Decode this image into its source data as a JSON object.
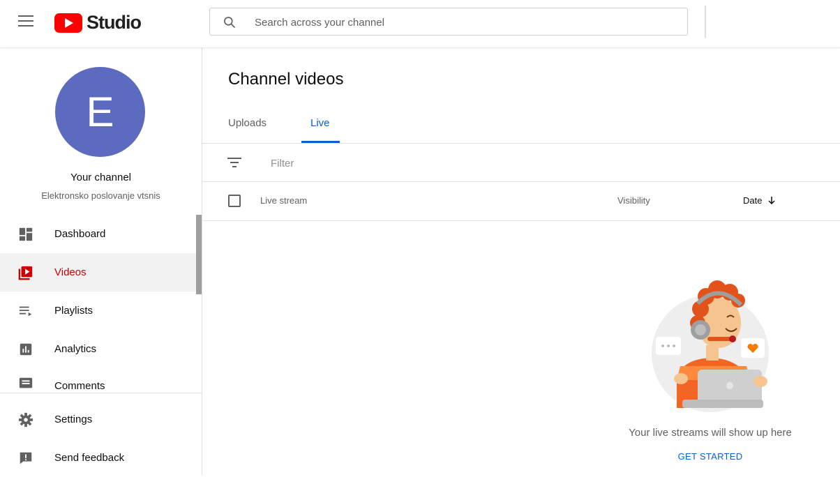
{
  "header": {
    "logo_text": "Studio",
    "search_placeholder": "Search across your channel"
  },
  "sidebar": {
    "avatar_letter": "E",
    "channel_title": "Your channel",
    "channel_name": "Elektronsko poslovanje vtsnis",
    "items": [
      {
        "label": "Dashboard",
        "icon": "dashboard-icon"
      },
      {
        "label": "Videos",
        "icon": "videos-icon",
        "active": true
      },
      {
        "label": "Playlists",
        "icon": "playlists-icon"
      },
      {
        "label": "Analytics",
        "icon": "analytics-icon"
      },
      {
        "label": "Comments",
        "icon": "comments-icon"
      }
    ],
    "footer_items": [
      {
        "label": "Settings",
        "icon": "gear-icon"
      },
      {
        "label": "Send feedback",
        "icon": "feedback-icon"
      }
    ]
  },
  "main": {
    "title": "Channel videos",
    "tabs": [
      {
        "label": "Uploads"
      },
      {
        "label": "Live",
        "active": true
      }
    ],
    "filter_placeholder": "Filter",
    "columns": {
      "live_stream": "Live stream",
      "visibility": "Visibility",
      "date": "Date"
    },
    "empty_state": {
      "message": "Your live streams will show up here",
      "action": "GET STARTED"
    }
  },
  "colors": {
    "accent": "#065fd4",
    "brand": "#ff0000",
    "active_nav": "#cc0000",
    "avatar": "#5c6bc0"
  }
}
